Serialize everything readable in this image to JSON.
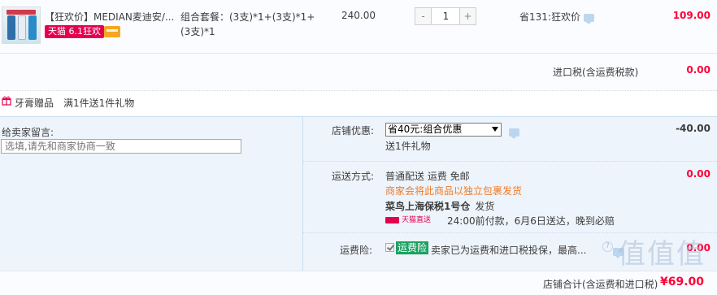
{
  "product": {
    "title": "【狂欢价】MEDIAN麦迪安/...",
    "badge_tmall": "天猫 6.1狂欢",
    "spec": "组合套餐：(3支)*1+(3支)*1+(3支)*1",
    "unit_price": "240.00",
    "quantity": "1",
    "minus": "-",
    "plus": "+",
    "saving": "省131:狂欢价",
    "total": "109.00"
  },
  "tax": {
    "label": "进口税(含运费税款)",
    "value": "0.00"
  },
  "gift": {
    "label": "牙膏赠品",
    "desc": "满1件送1件礼物"
  },
  "message": {
    "label": "给卖家留言:",
    "placeholder": "选填,请先和商家协商一致"
  },
  "shop_discount": {
    "label": "店铺优惠:",
    "selected": "省40元:组合优惠",
    "gift": "送1件礼物",
    "value": "-40.00"
  },
  "shipping": {
    "label": "运送方式:",
    "type": "普通配送 运费 免邮",
    "note": "商家会将此商品以独立包裹发货",
    "warehouse": "菜鸟上海保税1号仓",
    "warehouse_suffix": "发货",
    "direct_badge": "天猫直送",
    "time": "24:00前付款，6月6日送达，晚到必赔",
    "value": "0.00"
  },
  "insurance": {
    "label": "运费险:",
    "tag": "运费险",
    "desc": "卖家已为运费和进口税投保，最高...",
    "help": "?",
    "value": "0.00"
  },
  "watermark": "值值值",
  "total": {
    "label": "店铺合计(含运费和进口税)",
    "value": "¥69.00"
  },
  "colors": {
    "price_red": "#ff0036",
    "tmall_red": "#e5004f",
    "note_orange": "#f07a23",
    "insurance_green": "#1aa260",
    "panel_blue": "#eef4fb"
  }
}
